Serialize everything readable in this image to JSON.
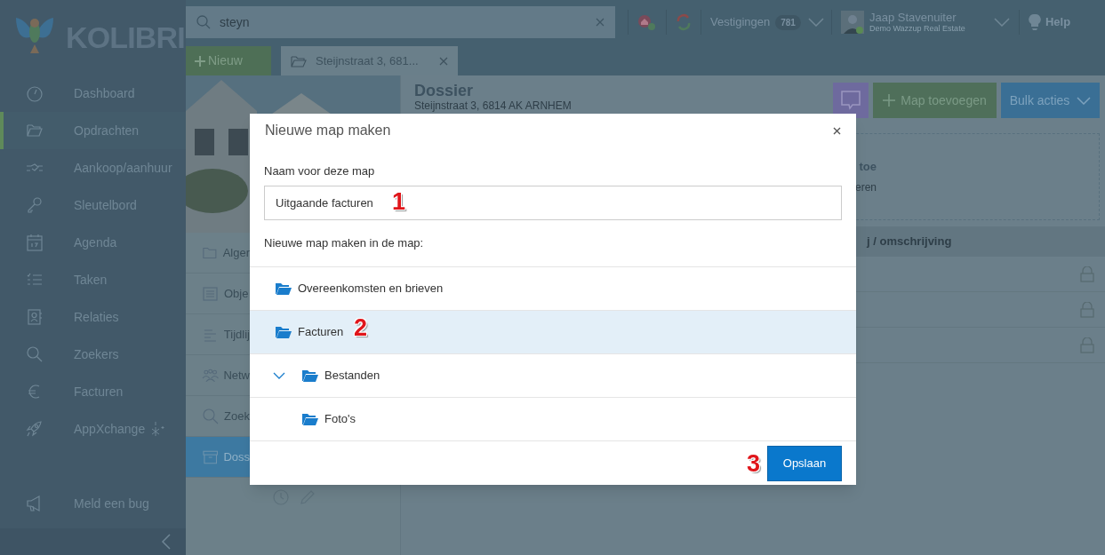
{
  "sidebar": {
    "logo": "KOLIBRI",
    "items": [
      {
        "label": "Dashboard",
        "selected": false
      },
      {
        "label": "Opdrachten",
        "selected": true
      },
      {
        "label": "Aankoop/aanhuur",
        "selected": false
      },
      {
        "label": "Sleutelbord",
        "selected": false
      },
      {
        "label": "Agenda",
        "selected": false
      },
      {
        "label": "Taken",
        "selected": false
      },
      {
        "label": "Relaties",
        "selected": false
      },
      {
        "label": "Zoekers",
        "selected": false
      },
      {
        "label": "Facturen",
        "selected": false
      },
      {
        "label": "AppXchange",
        "selected": false
      }
    ],
    "footer_item": "Meld een bug"
  },
  "topbar": {
    "search_value": "steyn",
    "branches_label": "Vestigingen",
    "branches_count": "781",
    "user_name": "Jaap Stavenuiter",
    "user_org": "Demo Wazzup Real Estate",
    "help": "Help"
  },
  "tabs": {
    "new_button": "Nieuw",
    "open_tab": "Steijnstraat 3, 681..."
  },
  "detail_nav": [
    {
      "label": "Alger",
      "selected": false
    },
    {
      "label": "Obje",
      "selected": false
    },
    {
      "label": "Tijdlij",
      "selected": false
    },
    {
      "label": "Netw",
      "selected": false
    },
    {
      "label": "Zoek",
      "selected": false
    },
    {
      "label": "Doss",
      "selected": true
    }
  ],
  "dossier": {
    "title": "Dossier",
    "subtitle": "Steijnstraat 3, 6814 AK ARNHEM",
    "add_button": "Map toevoegen",
    "bulk_button": "Bulk acties",
    "dropzone_title": "toe",
    "dropzone_text": "eren",
    "table_header": "j / omschrijving",
    "rows": [
      {
        "locked": true
      },
      {
        "locked": true
      },
      {
        "locked": true
      }
    ]
  },
  "modal": {
    "title": "Nieuwe map maken",
    "name_label": "Naam voor deze map",
    "name_value": "Uitgaande facturen",
    "location_label": "Nieuwe map maken in de map:",
    "folders": [
      {
        "label": "Overeenkomsten en brieven",
        "selected": false
      },
      {
        "label": "Facturen",
        "selected": true
      },
      {
        "label": "Bestanden",
        "selected": false,
        "expanded": true,
        "children": [
          {
            "label": "Foto's",
            "selected": false
          }
        ]
      }
    ],
    "save_button": "Opslaan"
  },
  "annotations": [
    "1",
    "2",
    "3"
  ]
}
